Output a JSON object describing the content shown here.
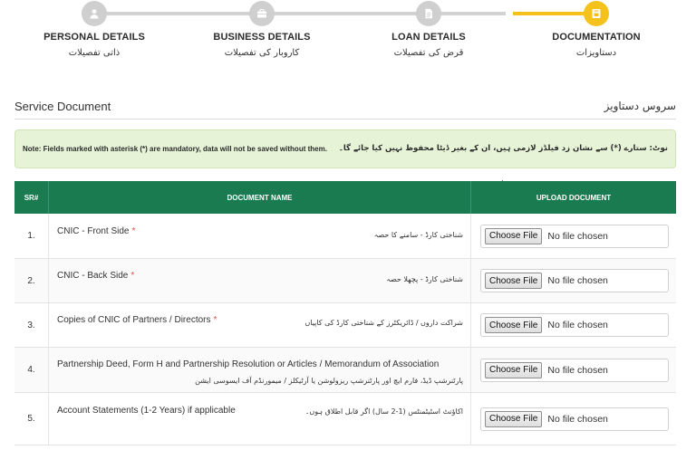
{
  "stepper": {
    "steps": [
      {
        "label": "PERSONAL DETAILS",
        "urdu": "ذاتی تفصیلات",
        "icon": "user-icon",
        "state": "done"
      },
      {
        "label": "BUSINESS DETAILS",
        "urdu": "کاروبار کی تفصیلات",
        "icon": "briefcase-icon",
        "state": "done"
      },
      {
        "label": "LOAN DETAILS",
        "urdu": "قرض کی تفصیلات",
        "icon": "document-icon",
        "state": "done"
      },
      {
        "label": "DOCUMENTATION",
        "urdu": "دستاویزات",
        "icon": "folder-icon",
        "state": "active"
      }
    ],
    "colors": {
      "inactive": "#cfcfcf",
      "active": "#f4c21b"
    }
  },
  "section": {
    "title": "Service Document",
    "title_urdu": "سروس دستاویز"
  },
  "note": {
    "text": "Note: Fields marked with asterisk (*) are mandatory, data will not be saved without them.",
    "text_urdu": "نوٹ: ستارے (*) سے نشان زد فیلڈز لازمی ہیں، ان کے بغیر ڈیٹا محفوظ نہیں کیا جائے گا۔"
  },
  "table": {
    "headers": {
      "sr": "SR#",
      "name": "DOCUMENT NAME",
      "upload": "UPLOAD DOCUMENT"
    },
    "header_color": "#1a7a50",
    "file_button": "Choose File",
    "file_status": "No file chosen",
    "rows": [
      {
        "sr": "1.",
        "name": "CNIC - Front Side",
        "required": "*",
        "urdu": "شناختی کارڈ - سامنے کا حصہ"
      },
      {
        "sr": "2.",
        "name": "CNIC - Back Side",
        "required": "*",
        "urdu": "شناختی کارڈ - پچھلا حصہ"
      },
      {
        "sr": "3.",
        "name": "Copies of CNIC of Partners / Directors",
        "required": "*",
        "urdu": "شراکت داروں / ڈائریکٹرز کے شناختی کارڈ کی کاپیاں"
      },
      {
        "sr": "4.",
        "name": "Partnership Deed, Form H and Partnership Resolution or Articles / Memorandum of Association",
        "required": "",
        "urdu": "پارٹنرشپ ڈیڈ، فارم ایچ اور پارٹنرشپ ریزولوشن یا آرٹیکلز / میمورنڈم آف ایسوسی ایشن"
      },
      {
        "sr": "5.",
        "name": "Account Statements (1-2 Years) if applicable",
        "required": "",
        "urdu": "اکاؤنٹ اسٹیٹمنٹس (1-2 سال) اگر قابل اطلاق ہوں۔"
      }
    ]
  }
}
